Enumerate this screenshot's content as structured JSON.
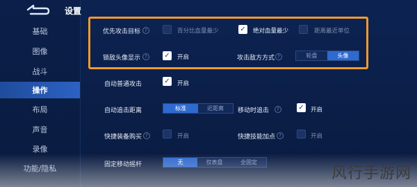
{
  "header": {
    "title": "设置"
  },
  "sidebar": {
    "items": [
      {
        "label": "基础",
        "active": false
      },
      {
        "label": "图像",
        "active": false
      },
      {
        "label": "战斗",
        "active": false
      },
      {
        "label": "操作",
        "active": true
      },
      {
        "label": "布局",
        "active": false
      },
      {
        "label": "声音",
        "active": false
      },
      {
        "label": "录像",
        "active": false
      },
      {
        "label": "功能/隐私",
        "active": false
      }
    ]
  },
  "settings": {
    "priority_target": {
      "label": "优先攻击目标",
      "option1": {
        "label": "百分比血量最少",
        "checked": false
      },
      "option2": {
        "label": "绝对血量最少",
        "checked": true
      },
      "option3": {
        "label": "距离最近单位",
        "checked": false
      }
    },
    "lock_avatar": {
      "label": "锁敌头像显示",
      "value": "开启",
      "checked": true
    },
    "enemy_mode": {
      "label": "攻击敌方方式",
      "options": [
        "轮盘",
        "头像"
      ],
      "selected": "头像"
    },
    "auto_attack": {
      "label": "自动普通攻击",
      "value": "开启",
      "checked": true
    },
    "auto_chase": {
      "label": "自动追击距离",
      "options": [
        "标准",
        "近距离"
      ],
      "selected": "标准"
    },
    "move_chase": {
      "label": "移动时追击",
      "value": "开启",
      "checked": true
    },
    "quick_buy": {
      "label": "快捷装备购买",
      "value": "开启",
      "checked": false
    },
    "quick_skill": {
      "label": "快捷技能加点",
      "value": "开启",
      "checked": false
    },
    "fixed_joystick": {
      "label": "固定移动摇杆",
      "options": [
        "无",
        "仅表盘",
        "全固定"
      ],
      "selected": "无"
    }
  },
  "watermark": "风行手游网",
  "colors": {
    "accent": "#2e6ad0",
    "highlight": "#f39a2c"
  }
}
